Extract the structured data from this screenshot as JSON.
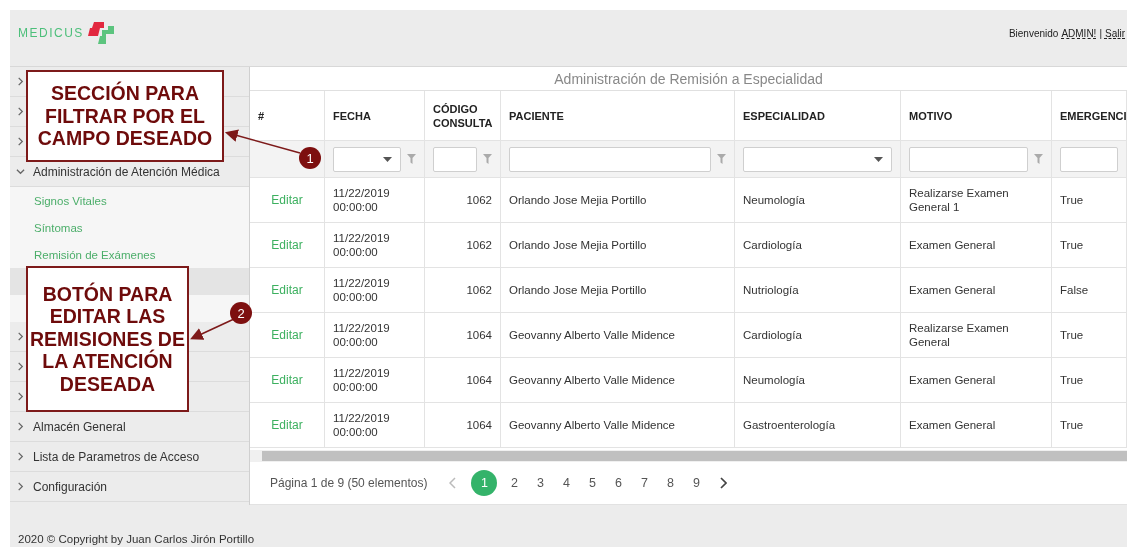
{
  "header": {
    "logo": "MEDICUS",
    "welcome": "Bienvenido",
    "user": "ADMIN!",
    "separator": "|",
    "logout": "Salir"
  },
  "sidebar": [
    {
      "expanded": false
    },
    {
      "expanded": false
    },
    {
      "expanded": false
    },
    {
      "label": "Administración de Atención Médica",
      "expanded": true,
      "children": [
        {
          "label": "Signos Vitales",
          "selected": false
        },
        {
          "label": "Síntomas",
          "selected": false
        },
        {
          "label": "Remisión de Exámenes",
          "selected": false
        },
        {
          "selected": true
        },
        {
          "selected": false
        }
      ]
    },
    {
      "expanded": false
    },
    {
      "expanded": false
    },
    {
      "expanded": false
    },
    {
      "label": "Almacén General",
      "expanded": false
    },
    {
      "label": "Lista de Parametros de Acceso",
      "expanded": false
    },
    {
      "label": "Configuración",
      "expanded": false
    }
  ],
  "table": {
    "title": "Administración de Remisión a Especialidad",
    "columns": [
      {
        "label": "#"
      },
      {
        "label": "FECHA",
        "filter": {
          "kind": "select",
          "icon": true
        }
      },
      {
        "label": "CÓDIGO CONSULTA",
        "filter": {
          "kind": "text",
          "icon": true
        }
      },
      {
        "label": "PACIENTE",
        "filter": {
          "kind": "text",
          "icon": true
        }
      },
      {
        "label": "ESPECIALIDAD",
        "filter": {
          "kind": "select",
          "icon": false
        }
      },
      {
        "label": "MOTIVO",
        "filter": {
          "kind": "text",
          "icon": true
        }
      },
      {
        "label": "EMERGENCI",
        "filter": {
          "kind": "text",
          "icon": false
        }
      }
    ],
    "rows": [
      {
        "cells": [
          "Editar",
          "11/22/2019 00:00:00",
          "1062",
          "Orlando Jose Mejia Portillo",
          "Neumología",
          "Realizarse Examen General 1",
          "True"
        ]
      },
      {
        "cells": [
          "Editar",
          "11/22/2019 00:00:00",
          "1062",
          "Orlando Jose Mejia Portillo",
          "Cardiología",
          "Examen General",
          "True"
        ]
      },
      {
        "cells": [
          "Editar",
          "11/22/2019 00:00:00",
          "1062",
          "Orlando Jose Mejia Portillo",
          "Nutriología",
          "Examen General",
          "False"
        ]
      },
      {
        "cells": [
          "Editar",
          "11/22/2019 00:00:00",
          "1064",
          "Geovanny Alberto Valle Midence",
          "Cardiología",
          "Realizarse Examen General",
          "True"
        ]
      },
      {
        "cells": [
          "Editar",
          "11/22/2019 00:00:00",
          "1064",
          "Geovanny Alberto Valle Midence",
          "Neumología",
          "Examen General",
          "True"
        ]
      },
      {
        "cells": [
          "Editar",
          "11/22/2019 00:00:00",
          "1064",
          "Geovanny Alberto Valle Midence",
          "Gastroenterología",
          "Examen General",
          "True"
        ]
      }
    ]
  },
  "pager": {
    "summary": "Página 1 de 9 (50 elementos)",
    "pages": [
      {
        "label": "1",
        "selected": true
      },
      {
        "label": "2",
        "selected": false
      },
      {
        "label": "3",
        "selected": false
      },
      {
        "label": "4",
        "selected": false
      },
      {
        "label": "5",
        "selected": false
      },
      {
        "label": "6",
        "selected": false
      },
      {
        "label": "7",
        "selected": false
      },
      {
        "label": "8",
        "selected": false
      },
      {
        "label": "9",
        "selected": false
      }
    ]
  },
  "annotations": [
    {
      "number": "1",
      "text": "SECCIÓN PARA FILTRAR POR EL CAMPO DESEADO"
    },
    {
      "number": "2",
      "text": "BOTÓN PARA EDITAR LAS REMISIONES DE LA ATENCIÓN DESEADA"
    }
  ],
  "footer": "2020 © Copyright by Juan Carlos Jirón Portillo"
}
